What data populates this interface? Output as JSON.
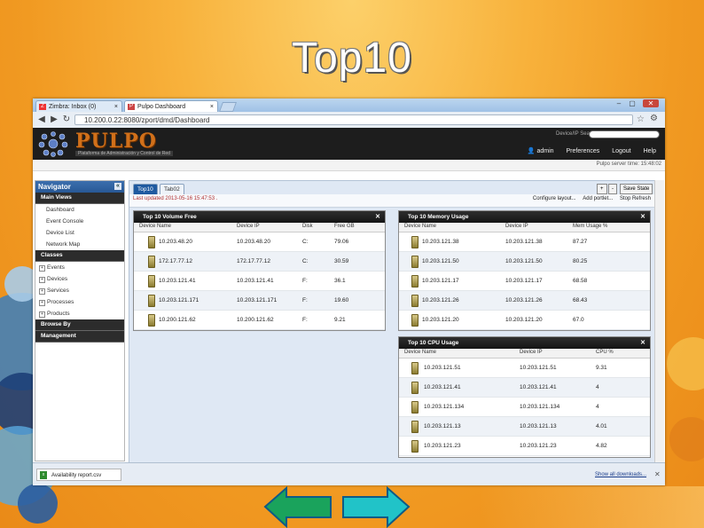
{
  "slide": {
    "title": "Top10"
  },
  "browser": {
    "tabs": [
      {
        "label": "Zimbra: Inbox (0)",
        "icon": "zimbra-icon"
      },
      {
        "label": "Pulpo Dashboard",
        "icon": "pulpo-icon"
      }
    ],
    "url": "10.200.0.22:8080/zport/dmd/Dashboard",
    "window_controls": [
      "–",
      "▢",
      "✕"
    ]
  },
  "app": {
    "logo_text": "PULPO",
    "logo_subtitle": "Plataforma de Administración y Control de Red",
    "device_search_label": "Device/IP Search",
    "device_search_placeholder": "",
    "user": "admin",
    "links": [
      "Preferences",
      "Logout",
      "Help"
    ],
    "server_time": "Pulpo server time: 15:48:02"
  },
  "navigator": {
    "title": "Navigator",
    "sections": [
      {
        "title": "Main Views",
        "items": [
          "Dashboard",
          "Event Console",
          "Device List",
          "Network Map"
        ]
      },
      {
        "title": "Classes",
        "items": [
          "Events",
          "Devices",
          "Services",
          "Processes",
          "Products"
        ]
      },
      {
        "title": "Browse By",
        "items": []
      },
      {
        "title": "Management",
        "items": []
      }
    ]
  },
  "dashboard": {
    "tabs": [
      "Top10",
      "Tab02"
    ],
    "buttons": [
      "+",
      "-",
      "Save State"
    ],
    "last_updated": "Last updated 2013-05-16 15:47:53 .",
    "actions": [
      "Configure layout...",
      "Add portlet...",
      "Stop Refresh"
    ]
  },
  "portlets": {
    "volume": {
      "title": "Top 10 Volume Free",
      "columns": [
        "Device Name",
        "Device IP",
        "Disk",
        "Free GB"
      ],
      "rows": [
        [
          "10.203.48.20",
          "10.203.48.20",
          "C:",
          "79.06"
        ],
        [
          "172.17.77.12",
          "172.17.77.12",
          "C:",
          "30.59"
        ],
        [
          "10.203.121.41",
          "10.203.121.41",
          "F:",
          "36.1"
        ],
        [
          "10.203.121.171",
          "10.203.121.171",
          "F:",
          "19.60"
        ],
        [
          "10.200.121.62",
          "10.200.121.62",
          "F:",
          "9.21"
        ]
      ]
    },
    "memory": {
      "title": "Top 10 Memory Usage",
      "columns": [
        "Device Name",
        "Device IP",
        "Mem Usage %"
      ],
      "rows": [
        [
          "10.203.121.38",
          "10.203.121.38",
          "87.27"
        ],
        [
          "10.203.121.50",
          "10.203.121.50",
          "80.25"
        ],
        [
          "10.203.121.17",
          "10.203.121.17",
          "68.58"
        ],
        [
          "10.203.121.26",
          "10.203.121.26",
          "68.43"
        ],
        [
          "10.203.121.20",
          "10.203.121.20",
          "67.0"
        ]
      ]
    },
    "cpu": {
      "title": "Top 10 CPU Usage",
      "columns": [
        "Device Name",
        "Device IP",
        "CPU %"
      ],
      "rows": [
        [
          "10.203.121.51",
          "10.203.121.51",
          "9.31"
        ],
        [
          "10.203.121.41",
          "10.203.121.41",
          "4"
        ],
        [
          "10.203.121.134",
          "10.203.121.134",
          "4"
        ],
        [
          "10.203.121.13",
          "10.203.121.13",
          "4.01"
        ],
        [
          "10.203.121.23",
          "10.203.121.23",
          "4.82"
        ]
      ]
    },
    "close_glyph": "✕"
  },
  "downloads": {
    "file": "Availability report.csv",
    "show_all": "Show all downloads...",
    "close": "✕"
  },
  "colors": {
    "accent": "#1f5aa0",
    "slide_bg": "#f3a12b",
    "arrow_green": "#1aa35c",
    "arrow_cyan": "#21c3c8"
  }
}
